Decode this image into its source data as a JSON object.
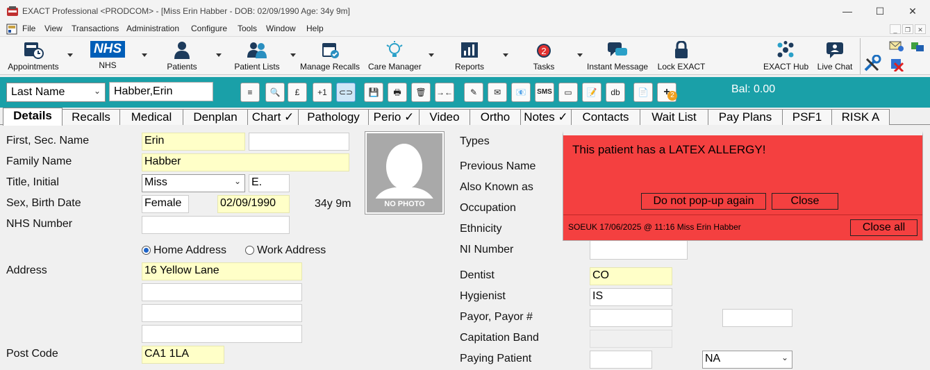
{
  "window": {
    "title": "EXACT Professional <PRODCOM> - [Miss Erin Habber - DOB: 02/09/1990 Age: 34y 9m]",
    "minimize": "—",
    "maximize": "☐",
    "close": "✕"
  },
  "menu": [
    "File",
    "View",
    "Transactions",
    "Administration",
    "Configure",
    "Tools",
    "Window",
    "Help"
  ],
  "mdi": {
    "minimize": "_",
    "restore": "❐",
    "close": "✕"
  },
  "toolbar": [
    {
      "label": "Appointments",
      "icon": "appointments-icon"
    },
    {
      "label": "NHS",
      "icon": "nhs-logo-icon",
      "logo_text": "NHS"
    },
    {
      "label": "Patients",
      "icon": "patient-icon"
    },
    {
      "label": "Patient Lists",
      "icon": "patient-lists-icon"
    },
    {
      "label": "Manage Recalls",
      "icon": "calendar-icon"
    },
    {
      "label": "Care Manager",
      "icon": "lightbulb-icon"
    },
    {
      "label": "Reports",
      "icon": "reports-icon"
    },
    {
      "label": "Tasks",
      "icon": "alarm-clock-icon",
      "badge": "2"
    },
    {
      "label": "Instant Message",
      "icon": "chat-icon"
    },
    {
      "label": "Lock EXACT",
      "icon": "lock-icon"
    },
    {
      "label": "EXACT Hub",
      "icon": "hub-icon"
    },
    {
      "label": "Live Chat",
      "icon": "live-chat-icon"
    }
  ],
  "search": {
    "field_select": "Last Name",
    "value": "Habber,Erin",
    "buttons": [
      "≡",
      "🔍",
      "£",
      "+1",
      "⊂⊃",
      "💾",
      "🖶",
      "🗑",
      "→←",
      "✎",
      "✉",
      "📧",
      "SMS",
      "▭",
      "📝",
      "db",
      "📄",
      "+"
    ],
    "balance": "Bal: 0.00",
    "badge": "2"
  },
  "tabs": [
    "Details",
    "Recalls",
    "Medical",
    "Denplan",
    "Chart ✓",
    "Pathology",
    "Perio ✓",
    "Video",
    "Ortho",
    "Notes ✓",
    "Contacts",
    "Wait List",
    "Pay Plans",
    "PSF1",
    "RISK A"
  ],
  "details": {
    "first_sec_name_label": "First, Sec. Name",
    "first_name": "Erin",
    "second_name": "",
    "family_name_label": "Family Name",
    "family_name": "Habber",
    "title_initial_label": "Title, Initial",
    "title": "Miss",
    "initial": "E.",
    "sex_birth_label": "Sex, Birth Date",
    "sex": "Female",
    "birth_date": "02/09/1990",
    "age": "34y 9m",
    "nhs_number_label": "NHS Number",
    "nhs_number": "",
    "home_address_label": "Home Address",
    "work_address_label": "Work Address",
    "address_label": "Address",
    "address_lines": [
      "16 Yellow Lane",
      "",
      "",
      ""
    ],
    "post_code_label": "Post Code",
    "post_code": "CA1 1LA",
    "photo_text": "NO PHOTO"
  },
  "right": {
    "types_label": "Types",
    "previous_name_label": "Previous Name",
    "aka_label": "Also Known as",
    "occupation_label": "Occupation",
    "ethnicity_label": "Ethnicity",
    "ni_number_label": "NI Number",
    "dentist_label": "Dentist",
    "dentist": "CO",
    "hygienist_label": "Hygienist",
    "hygienist": "IS",
    "payor_label": "Payor, Payor #",
    "capitation_label": "Capitation Band",
    "paying_patient_label": "Paying Patient",
    "paying_select": "NA"
  },
  "popup": {
    "message": "This patient has a LATEX ALLERGY!",
    "do_not_popup": "Do not pop-up again",
    "close": "Close",
    "footer": "SOEUK 17/06/2025 @ 11:16 Miss Erin Habber",
    "close_all": "Close all"
  },
  "colors": {
    "teal": "#1aa0a8",
    "alert": "#f44040",
    "field_yellow": "#ffffc8"
  }
}
